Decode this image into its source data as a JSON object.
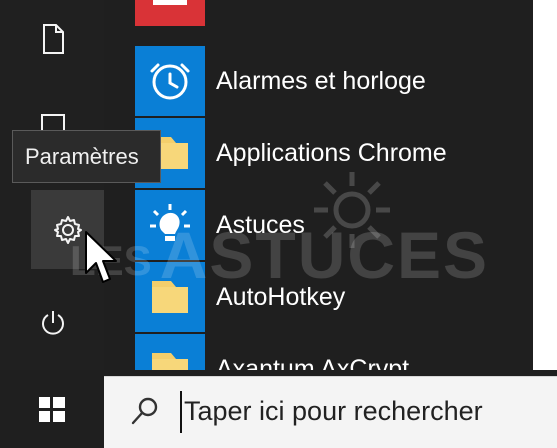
{
  "tooltip": {
    "text": "Paramètres"
  },
  "apps": [
    {
      "label": "Alarmes et horloge",
      "icon": "alarm-clock-icon"
    },
    {
      "label": "Applications Chrome",
      "icon": "folder-icon"
    },
    {
      "label": "Astuces",
      "icon": "lightbulb-icon"
    },
    {
      "label": "AutoHotkey",
      "icon": "folder-icon"
    },
    {
      "label": "Axantum AxCrypt",
      "icon": "folder-icon"
    }
  ],
  "watermark": {
    "prefix": "LES",
    "main": "ASTUCES"
  },
  "search": {
    "placeholder": "Taper ici pour rechercher"
  },
  "colors": {
    "menu_background": "#1f1f1f",
    "tile_blue": "#0a7fd6",
    "tile_red": "#d93337",
    "folder_yellow": "#f3ce6b",
    "search_background": "#f4f4f4"
  }
}
